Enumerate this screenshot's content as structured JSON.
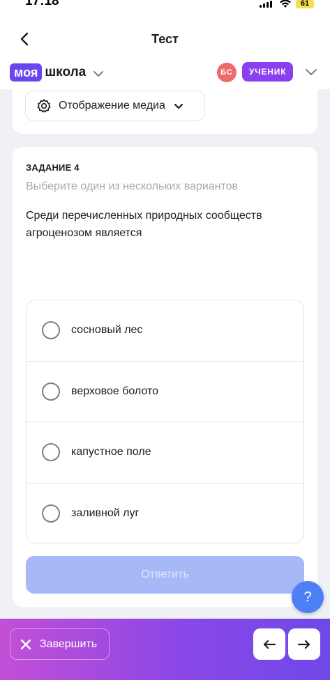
{
  "status_bar": {
    "time": "17:18",
    "battery": "61"
  },
  "header": {
    "title": "Тест",
    "brand_part1": "моя",
    "brand_part2": "школа",
    "avatar_initials": "БС",
    "role": "УЧЕНИК"
  },
  "media_toggle": {
    "label": "Отображение медиа"
  },
  "task": {
    "number": "ЗАДАНИЕ 4",
    "hint": "Выберите один из нескольких вариантов",
    "question": "Среди перечисленных природных сообществ агроценозом является",
    "options": [
      {
        "label": "сосновый лес"
      },
      {
        "label": "верховое болото"
      },
      {
        "label": "капустное поле"
      },
      {
        "label": "заливной луг"
      }
    ],
    "submit_label": "Ответить"
  },
  "help": {
    "label": "?"
  },
  "bottom": {
    "finish_label": "Завершить"
  },
  "colors": {
    "brand": "#6a47ec",
    "role_badge": "#8a3ff0",
    "avatar": "#f06a6a",
    "submit_disabled": "#a7b8f7",
    "help": "#4e80f5"
  }
}
